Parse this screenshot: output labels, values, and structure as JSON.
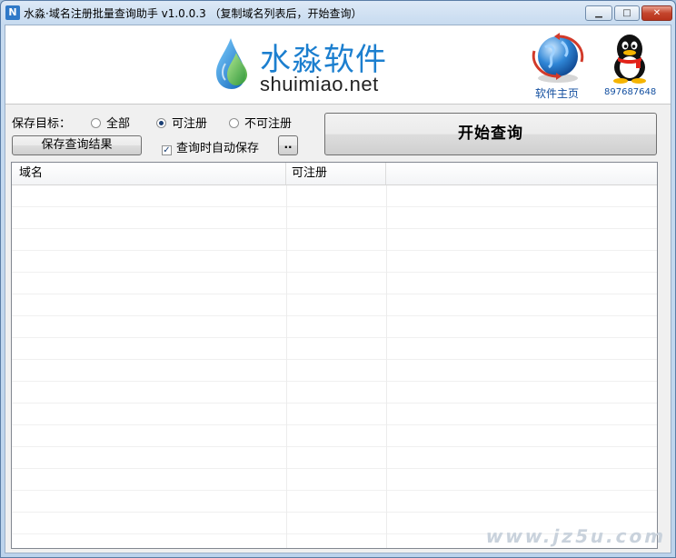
{
  "window": {
    "title": "水淼·域名注册批量查询助手 v1.0.0.3    （复制域名列表后，开始查询）",
    "icon": "app-icon",
    "controls": {
      "minimize_icon": "minimize-icon",
      "maximize_icon": "maximize-icon",
      "close_icon": "close-icon"
    }
  },
  "banner": {
    "logo_cn": "水淼软件",
    "logo_en": "shuimiao.net",
    "homepage_label": "软件主页",
    "qq_label": "897687648"
  },
  "options": {
    "save_target_label": "保存目标：",
    "radio_all": "全部",
    "radio_registrable": "可注册",
    "radio_unregistrable": "不可注册",
    "selected": "可注册",
    "save_results_button": "保存查询结果",
    "auto_save_label": "查询时自动保存",
    "auto_save_checked": true,
    "browse_button": "..",
    "start_button": "开始查询"
  },
  "table": {
    "columns": [
      "域名",
      "可注册",
      ""
    ],
    "rows": []
  },
  "watermark": "www.jz5u.com",
  "colors": {
    "accent": "#1c7fcf",
    "link": "#1450a0",
    "close": "#c4452c"
  }
}
